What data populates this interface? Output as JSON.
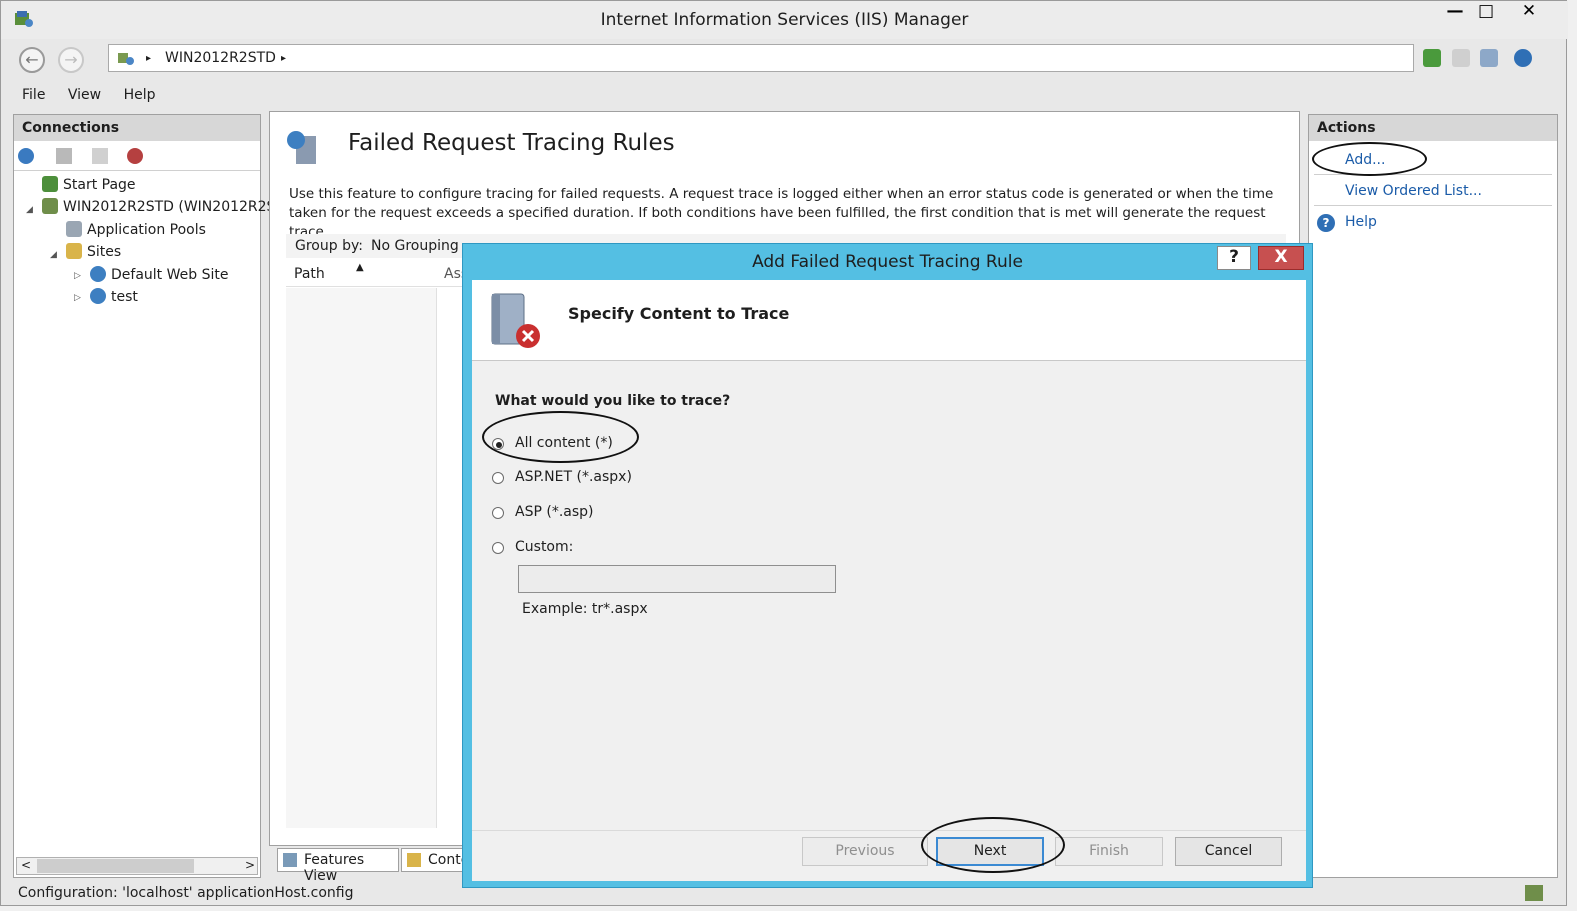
{
  "window": {
    "title": "Internet Information Services (IIS) Manager",
    "minimize": "—",
    "maximize": "□",
    "close": "✕"
  },
  "address": {
    "path_item": "WIN2012R2STD",
    "separator": "▸"
  },
  "menu": [
    "File",
    "View",
    "Help"
  ],
  "connections": {
    "title": "Connections",
    "tree": {
      "start_page": "Start Page",
      "server": "WIN2012R2STD (WIN2012R2S",
      "app_pools": "Application Pools",
      "sites": "Sites",
      "default_site": "Default Web Site",
      "test_site": "test"
    }
  },
  "feature": {
    "title": "Failed Request Tracing Rules",
    "description": "Use this feature to configure tracing for failed requests. A request trace is logged either when an error status code is generated or when the time taken for the request exceeds a specified duration. If both conditions have been fulfilled, the first condition that is met will generate the request trace.",
    "group_by_label": "Group by:",
    "group_by_value": "No Grouping",
    "col_path": "Path",
    "col_assoc": "Ass"
  },
  "views": {
    "features": "Features View",
    "content": "Conte"
  },
  "actions": {
    "title": "Actions",
    "add": "Add...",
    "view_ordered": "View Ordered List...",
    "help": "Help"
  },
  "status": {
    "text": "Configuration: 'localhost' applicationHost.config"
  },
  "dialog": {
    "title": "Add Failed Request Tracing Rule",
    "help_btn": "?",
    "close_btn": "X",
    "header": "Specify Content to Trace",
    "question": "What would you like to trace?",
    "options": [
      {
        "label": "All content (*)",
        "selected": true
      },
      {
        "label": "ASP.NET (*.aspx)",
        "selected": false
      },
      {
        "label": "ASP (*.asp)",
        "selected": false
      },
      {
        "label": "Custom:",
        "selected": false
      }
    ],
    "custom_value": "",
    "example": "Example: tr*.aspx",
    "buttons": {
      "previous": "Previous",
      "next": "Next",
      "finish": "Finish",
      "cancel": "Cancel"
    }
  },
  "colors": {
    "dialog_frame": "#54bfe3",
    "close_red": "#c75050",
    "link_blue": "#1a5ba8"
  }
}
